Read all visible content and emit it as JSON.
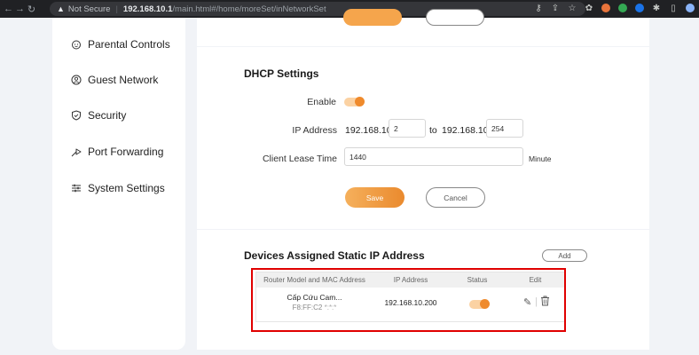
{
  "browser": {
    "not_secure": "Not Secure",
    "separator": "|",
    "host": "192.168.10.1",
    "path": "/main.html#/home/moreSet/inNetworkSet"
  },
  "sidebar": {
    "items": [
      {
        "label": "Parental Controls",
        "icon": "parental-controls-icon"
      },
      {
        "label": "Guest Network",
        "icon": "guest-network-icon"
      },
      {
        "label": "Security",
        "icon": "shield-icon"
      },
      {
        "label": "Port Forwarding",
        "icon": "port-forwarding-icon"
      },
      {
        "label": "System Settings",
        "icon": "sliders-icon"
      }
    ]
  },
  "dhcp": {
    "title": "DHCP Settings",
    "enable_label": "Enable",
    "enabled": true,
    "ip_label": "IP Address",
    "ip_prefix_start": "192.168.10.",
    "ip_start": "2",
    "to_label": "to",
    "ip_prefix_end": "192.168.10.",
    "ip_end": "254",
    "lease_label": "Client Lease Time",
    "lease_value": "1440",
    "lease_unit": "Minute",
    "save_label": "Save",
    "cancel_label": "Cancel"
  },
  "static_ip": {
    "title": "Devices Assigned Static IP Address",
    "add_label": "Add",
    "columns": [
      "Router Model and MAC Address",
      "IP Address",
      "Status",
      "Edit"
    ],
    "rows": [
      {
        "device": "Cấp Cứu Cam...",
        "mac": "F8:FF:C2",
        "mac_masked": "*:*:*",
        "ip": "192.168.10.200",
        "status_on": true
      }
    ]
  },
  "colors": {
    "accent": "#ef8a2c",
    "highlight": "#e00000"
  }
}
